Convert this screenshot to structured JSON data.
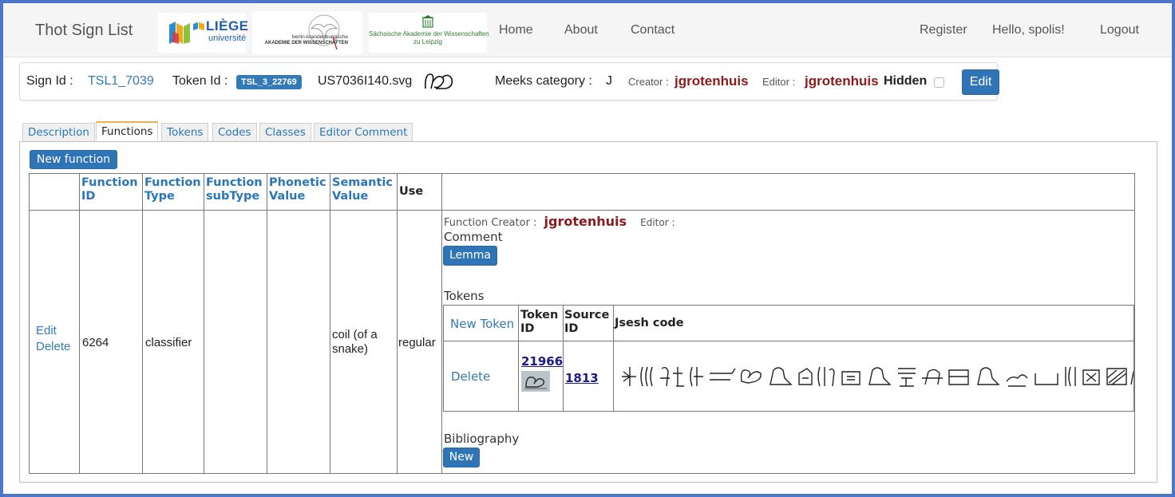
{
  "navbar": {
    "brand": "Thot Sign List",
    "logos": {
      "liege_main": "LIÈGE",
      "liege_sub": "université",
      "bbaw_line1": "berlin-brandenburgische",
      "bbaw_line2": "AKADEMIE DER WISSENSCHAFTEN",
      "saw_line1": "Sächsische Akademie der Wissenschaften",
      "saw_line2": "zu Leipzig"
    },
    "links": [
      "Home",
      "About",
      "Contact"
    ],
    "right_links": [
      "Register",
      "Hello, spolis!",
      "Logout"
    ]
  },
  "sign": {
    "sign_id_label": "Sign Id :",
    "sign_id": "TSL1_7039",
    "token_id_label": "Token Id :",
    "token_id": "TSL_3_22769",
    "filename": "US7036I140.svg",
    "meeks_label": "Meeks category :",
    "meeks_value": "J",
    "creator_label": "Creator :",
    "creator": "jgrotenhuis",
    "editor_label": "Editor :",
    "editor": "jgrotenhuis",
    "hidden_label": "Hidden",
    "edit_button": "Edit"
  },
  "tabs": [
    {
      "label": "Description",
      "active": false
    },
    {
      "label": "Functions",
      "active": true
    },
    {
      "label": "Tokens",
      "active": false
    },
    {
      "label": "Codes",
      "active": false
    },
    {
      "label": "Classes",
      "active": false
    },
    {
      "label": "Editor Comment",
      "active": false
    }
  ],
  "new_function_button": "New function",
  "functions_table": {
    "headers": {
      "function_id": [
        "Function",
        "ID"
      ],
      "function_type": [
        "Function",
        "Type"
      ],
      "function_subtype": [
        "Function",
        "subType"
      ],
      "phonetic_value": [
        "Phonetic",
        "Value"
      ],
      "semantic_value": [
        "Semantic",
        "Value"
      ],
      "use": "Use"
    },
    "row": {
      "edit": "Edit",
      "delete": "Delete",
      "function_id": "6264",
      "function_type": "classifier",
      "function_subtype": "",
      "phonetic_value": "",
      "semantic_value": [
        "coil (of a",
        "snake)"
      ],
      "use": "regular",
      "details": {
        "creator_label": "Function Creator :",
        "creator": "jgrotenhuis",
        "editor_label": "Editor :",
        "comment_label": "Comment",
        "lemma_button": "Lemma",
        "tokens_label": "Tokens",
        "tokens_table": {
          "new_token": "New Token",
          "headers": {
            "token_id": [
              "Token",
              "ID"
            ],
            "source_id": [
              "Source",
              "ID"
            ],
            "jsesh": "Jsesh code"
          },
          "rows": [
            {
              "action": "Delete",
              "token_id": "21966",
              "source_id": "1813"
            }
          ]
        },
        "bibliography_label": "Bibliography",
        "new_button": "New"
      }
    }
  },
  "colors": {
    "link_blue": "#337ab7",
    "button_blue": "#2f74b5",
    "maroon": "#8b1a1a",
    "frame_blue": "#4a77c9",
    "active_tab_accent": "#f0ad4e"
  }
}
